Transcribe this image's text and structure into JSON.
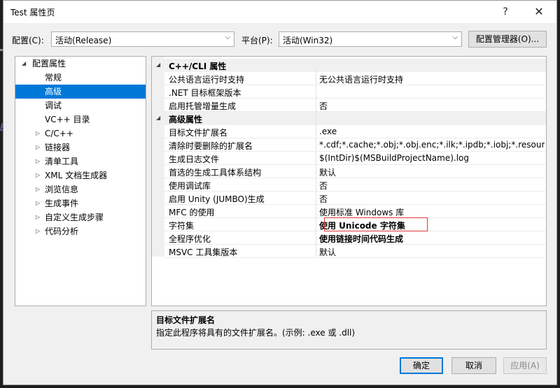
{
  "window": {
    "title": "Test 属性页",
    "help": "?",
    "close": "✕"
  },
  "config": {
    "label": "配置(C):",
    "value": "活动(Release)"
  },
  "platform": {
    "label": "平台(P):",
    "value": "活动(Win32)"
  },
  "config_manager": "配置管理器(O)...",
  "tree": {
    "items": [
      {
        "label": "配置属性",
        "level": 0,
        "toggle": "expanded"
      },
      {
        "label": "常规",
        "level": 1
      },
      {
        "label": "高级",
        "level": 1,
        "selected": true
      },
      {
        "label": "调试",
        "level": 1
      },
      {
        "label": "VC++ 目录",
        "level": 1
      },
      {
        "label": "C/C++",
        "level": 1,
        "toggle": "collapsed"
      },
      {
        "label": "链接器",
        "level": 1,
        "toggle": "collapsed"
      },
      {
        "label": "清单工具",
        "level": 1,
        "toggle": "collapsed"
      },
      {
        "label": "XML 文档生成器",
        "level": 1,
        "toggle": "collapsed"
      },
      {
        "label": "浏览信息",
        "level": 1,
        "toggle": "collapsed"
      },
      {
        "label": "生成事件",
        "level": 1,
        "toggle": "collapsed"
      },
      {
        "label": "自定义生成步骤",
        "level": 1,
        "toggle": "collapsed"
      },
      {
        "label": "代码分析",
        "level": 1,
        "toggle": "collapsed"
      }
    ]
  },
  "grid": {
    "sections": [
      {
        "title": "C++/CLI 属性",
        "rows": [
          {
            "name": "公共语言运行时支持",
            "value": "无公共语言运行时支持"
          },
          {
            "name": ".NET 目标框架版本",
            "value": ""
          },
          {
            "name": "启用托管增量生成",
            "value": "否"
          }
        ]
      },
      {
        "title": "高级属性",
        "rows": [
          {
            "name": "目标文件扩展名",
            "value": ".exe"
          },
          {
            "name": "清除时要删除的扩展名",
            "value": "*.cdf;*.cache;*.obj;*.obj.enc;*.ilk;*.ipdb;*.iobj;*.resources;*"
          },
          {
            "name": "生成日志文件",
            "value": "$(IntDir)$(MSBuildProjectName).log"
          },
          {
            "name": "首选的生成工具体系结构",
            "value": "默认"
          },
          {
            "name": "使用调试库",
            "value": "否"
          },
          {
            "name": "启用 Unity (JUMBO)生成",
            "value": "否"
          },
          {
            "name": "MFC 的使用",
            "value": "使用标准 Windows 库"
          },
          {
            "name": "字符集",
            "value": "使用 Unicode 字符集",
            "bold": true,
            "highlight": "#e0393a"
          },
          {
            "name": "全程序优化",
            "value": "使用链接时间代码生成",
            "bold": true
          },
          {
            "name": "MSVC 工具集版本",
            "value": "默认"
          }
        ]
      }
    ]
  },
  "description": {
    "title": "目标文件扩展名",
    "text": "指定此程序将具有的文件扩展名。(示例: .exe 或 .dll)"
  },
  "buttons": {
    "ok": "确定",
    "cancel": "取消",
    "apply": "应用(A)"
  },
  "colors": {
    "accent": "#0078d7",
    "highlight_border": "#e0393a"
  }
}
